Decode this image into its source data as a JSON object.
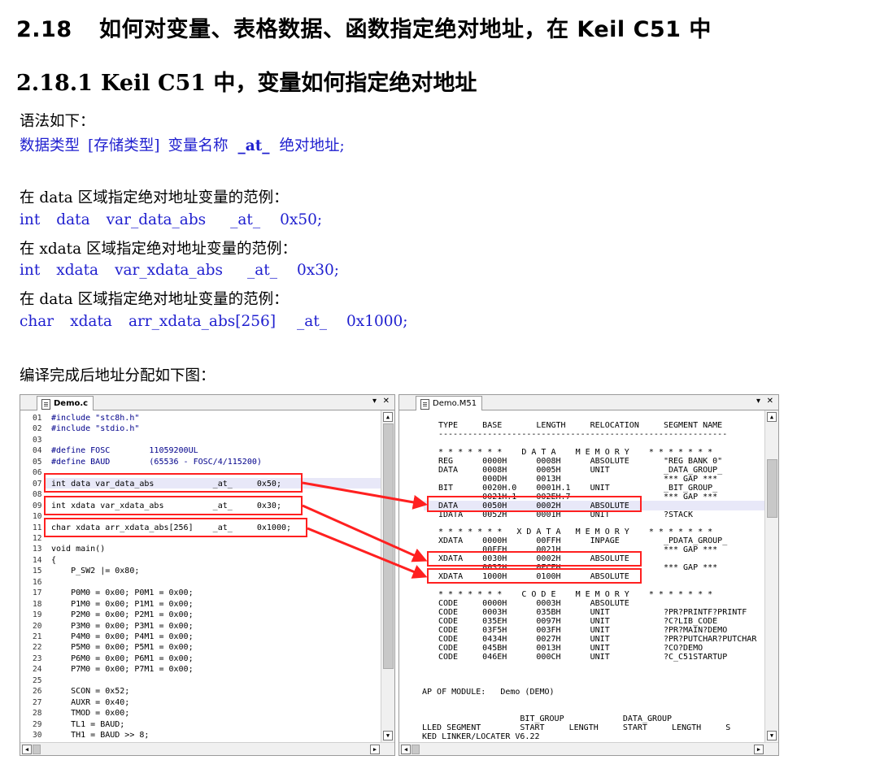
{
  "heading1": {
    "number": "2.18",
    "text": "如何对变量、表格数据、函数指定绝对地址，在 Keil C51 中"
  },
  "heading2": {
    "number": "2.18.1",
    "text": "Keil C51 中，变量如何指定绝对地址"
  },
  "syntax": {
    "intro": "语法如下：",
    "parts": [
      "数据类型",
      "[存储类型]",
      "变量名称",
      "_at_",
      "绝对地址;"
    ]
  },
  "examples": [
    {
      "desc": "在 data 区域指定绝对地址变量的范例：",
      "code": [
        "int",
        "data",
        "var_data_abs",
        "_at_",
        "0x50;"
      ]
    },
    {
      "desc": "在 xdata 区域指定绝对地址变量的范例：",
      "code": [
        "int",
        "xdata",
        "var_xdata_abs",
        "_at_",
        "0x30;"
      ]
    },
    {
      "desc": "在 data 区域指定绝对地址变量的范例：",
      "code": [
        "char",
        "xdata",
        "arr_xdata_abs[256]",
        "_at_",
        "0x1000;"
      ]
    }
  ],
  "caption": "编译完成后地址分配如下图：",
  "left_pane": {
    "tab": "Demo.c",
    "lines": [
      {
        "n": "01",
        "t": "#include \"stc8h.h\""
      },
      {
        "n": "02",
        "t": "#include \"stdio.h\""
      },
      {
        "n": "03",
        "t": ""
      },
      {
        "n": "04",
        "t": "#define FOSC        11059200UL"
      },
      {
        "n": "05",
        "t": "#define BAUD        (65536 - FOSC/4/115200)"
      },
      {
        "n": "06",
        "t": ""
      },
      {
        "n": "07",
        "t": "int data var_data_abs            _at_     0x50;"
      },
      {
        "n": "08",
        "t": ""
      },
      {
        "n": "09",
        "t": "int xdata var_xdata_abs          _at_     0x30;"
      },
      {
        "n": "10",
        "t": ""
      },
      {
        "n": "11",
        "t": "char xdata arr_xdata_abs[256]    _at_     0x1000;"
      },
      {
        "n": "12",
        "t": ""
      },
      {
        "n": "13",
        "t": "void main()"
      },
      {
        "n": "14",
        "t": "{"
      },
      {
        "n": "15",
        "t": "    P_SW2 |= 0x80;"
      },
      {
        "n": "16",
        "t": ""
      },
      {
        "n": "17",
        "t": "    P0M0 = 0x00; P0M1 = 0x00;"
      },
      {
        "n": "18",
        "t": "    P1M0 = 0x00; P1M1 = 0x00;"
      },
      {
        "n": "19",
        "t": "    P2M0 = 0x00; P2M1 = 0x00;"
      },
      {
        "n": "20",
        "t": "    P3M0 = 0x00; P3M1 = 0x00;"
      },
      {
        "n": "21",
        "t": "    P4M0 = 0x00; P4M1 = 0x00;"
      },
      {
        "n": "22",
        "t": "    P5M0 = 0x00; P5M1 = 0x00;"
      },
      {
        "n": "23",
        "t": "    P6M0 = 0x00; P6M1 = 0x00;"
      },
      {
        "n": "24",
        "t": "    P7M0 = 0x00; P7M1 = 0x00;"
      },
      {
        "n": "25",
        "t": ""
      },
      {
        "n": "26",
        "t": "    SCON = 0x52;"
      },
      {
        "n": "27",
        "t": "    AUXR = 0x40;"
      },
      {
        "n": "28",
        "t": "    TMOD = 0x00;"
      },
      {
        "n": "29",
        "t": "    TL1 = BAUD;"
      },
      {
        "n": "30",
        "t": "    TH1 = BAUD >> 8;"
      }
    ]
  },
  "right_pane": {
    "tab": "Demo.M51",
    "lines": [
      "TYPE     BASE       LENGTH     RELOCATION     SEGMENT NAME",
      "-----------------------------------------------------------",
      "",
      "* * * * * * *    D A T A    M E M O R Y    * * * * * * *",
      "REG      0000H      0008H      ABSOLUTE       \"REG BANK 0\"",
      "DATA     0008H      0005H      UNIT           _DATA_GROUP_",
      "         000DH      0013H                     *** GAP ***",
      "BIT      0020H.0    0001H.1    UNIT           _BIT_GROUP_",
      "         0021H.1    002EH.7                   *** GAP ***",
      "DATA     0050H      0002H      ABSOLUTE",
      "IDATA    0052H      0001H      UNIT           ?STACK",
      "",
      "* * * * * * *   X D A T A   M E M O R Y    * * * * * * *",
      "XDATA    0000H      00FFH      INPAGE         _PDATA_GROUP_",
      "         00FFH      0021H                     *** GAP ***",
      "XDATA    0030H      0002H      ABSOLUTE",
      "         0032H      0FCEH                     *** GAP ***",
      "XDATA    1000H      0100H      ABSOLUTE",
      "",
      "* * * * * * *    C O D E    M E M O R Y    * * * * * * *",
      "CODE     0000H      0003H      ABSOLUTE",
      "CODE     0003H      035BH      UNIT           ?PR?PRINTF?PRINTF",
      "CODE     035EH      0097H      UNIT           ?C?LIB_CODE",
      "CODE     03F5H      003FH      UNIT           ?PR?MAIN?DEMO",
      "CODE     0434H      0027H      UNIT           ?PR?PUTCHAR?PUTCHAR",
      "CODE     045BH      0013H      UNIT           ?CO?DEMO",
      "CODE     046EH      000CH      UNIT           ?C_C51STARTUP"
    ],
    "module_line": "AP OF MODULE:   Demo (DEMO)",
    "footer_lines": [
      "                    BIT_GROUP            DATA_GROUP",
      "LLED SEGMENT        START     LENGTH     START     LENGTH     S",
      "KED LINKER/LOCATER V6.22"
    ]
  }
}
